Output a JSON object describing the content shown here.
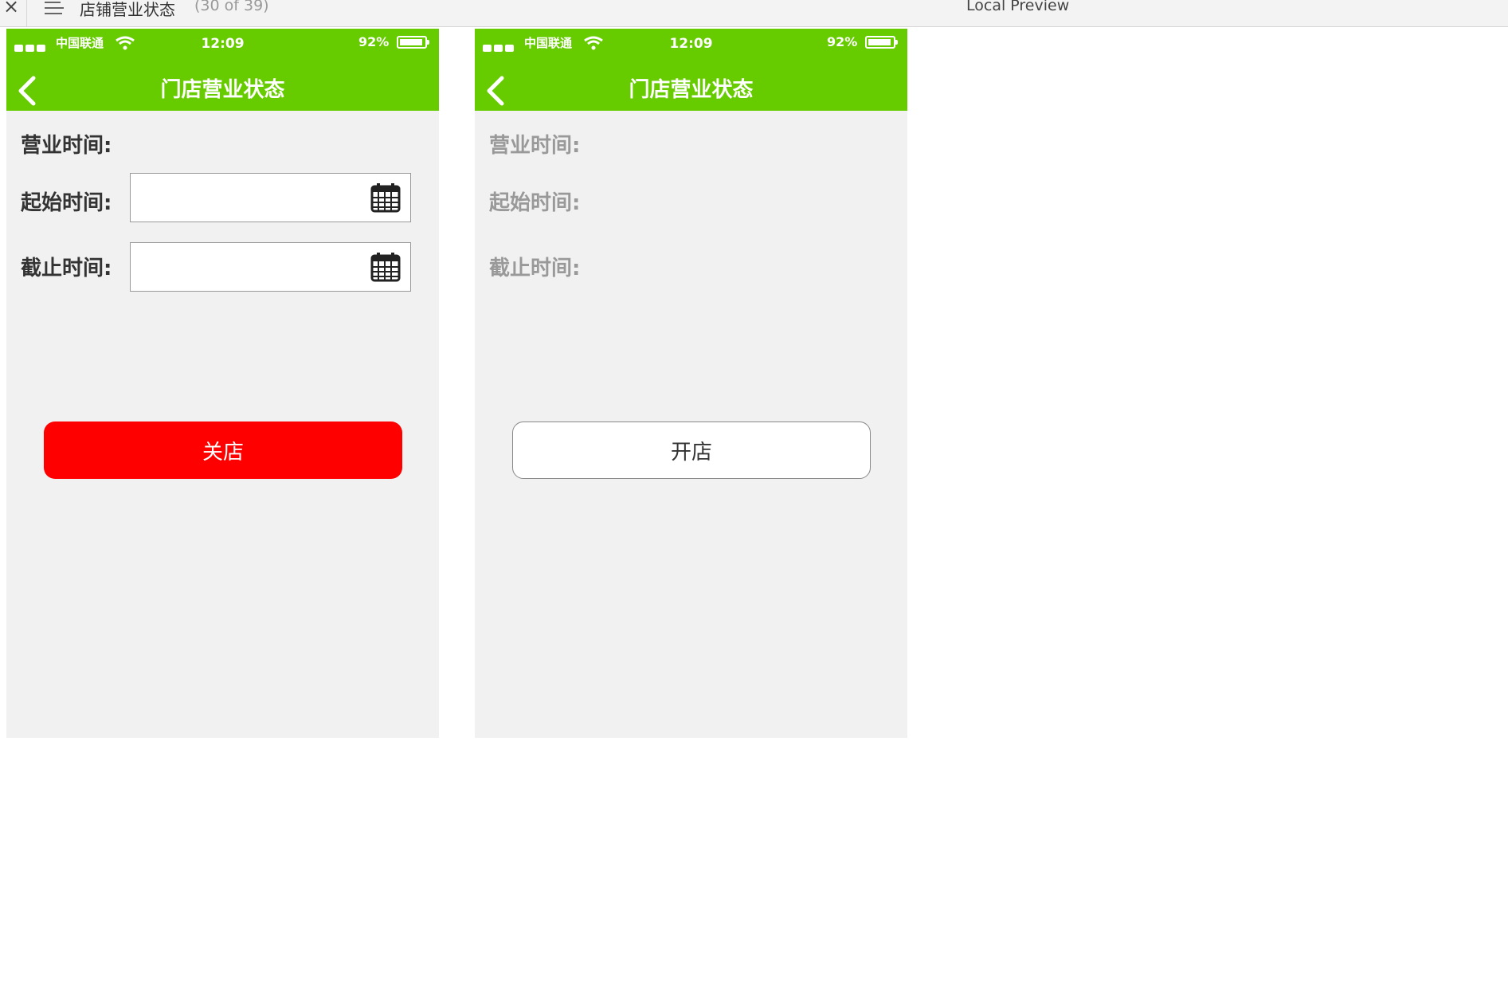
{
  "preview_bar": {
    "close": "×",
    "title": "店铺营业状态",
    "counter": "(30 of 39)",
    "mode": "Local Preview"
  },
  "screens": [
    {
      "status": {
        "carrier": "中国联通",
        "time": "12:09",
        "battery": "92%",
        "battery_level": 0.92
      },
      "nav_title": "门店营业状态",
      "hours_label": "营业时间:",
      "start_label": "起始时间:",
      "end_label": "截止时间:",
      "button_label": "关店"
    },
    {
      "status": {
        "carrier": "中国联通",
        "time": "12:09",
        "battery": "92%",
        "battery_level": 0.92
      },
      "nav_title": "门店营业状态",
      "hours_label": "营业时间:",
      "start_label": "起始时间:",
      "end_label": "截止时间:",
      "button_label": "开店"
    }
  ],
  "colors": {
    "header": "#66cc00",
    "close_button": "#ff0000",
    "background": "#f1f1f1"
  }
}
